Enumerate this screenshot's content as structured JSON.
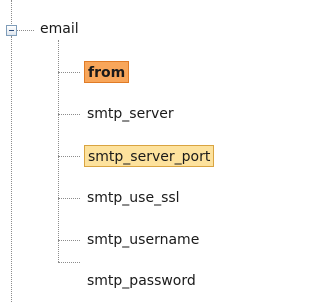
{
  "tree": {
    "root": {
      "label": "email",
      "expanded": true
    },
    "children": [
      {
        "label": "from",
        "state": "selected"
      },
      {
        "label": "smtp_server",
        "state": "normal"
      },
      {
        "label": "smtp_server_port",
        "state": "highlighted"
      },
      {
        "label": "smtp_use_ssl",
        "state": "normal"
      },
      {
        "label": "smtp_username",
        "state": "normal"
      },
      {
        "label": "smtp_password",
        "state": "normal"
      }
    ]
  },
  "colors": {
    "selected_fill": "#f8a65a",
    "highlight_fill": "#fde29d",
    "guide_lines": "#8c8c8c"
  }
}
